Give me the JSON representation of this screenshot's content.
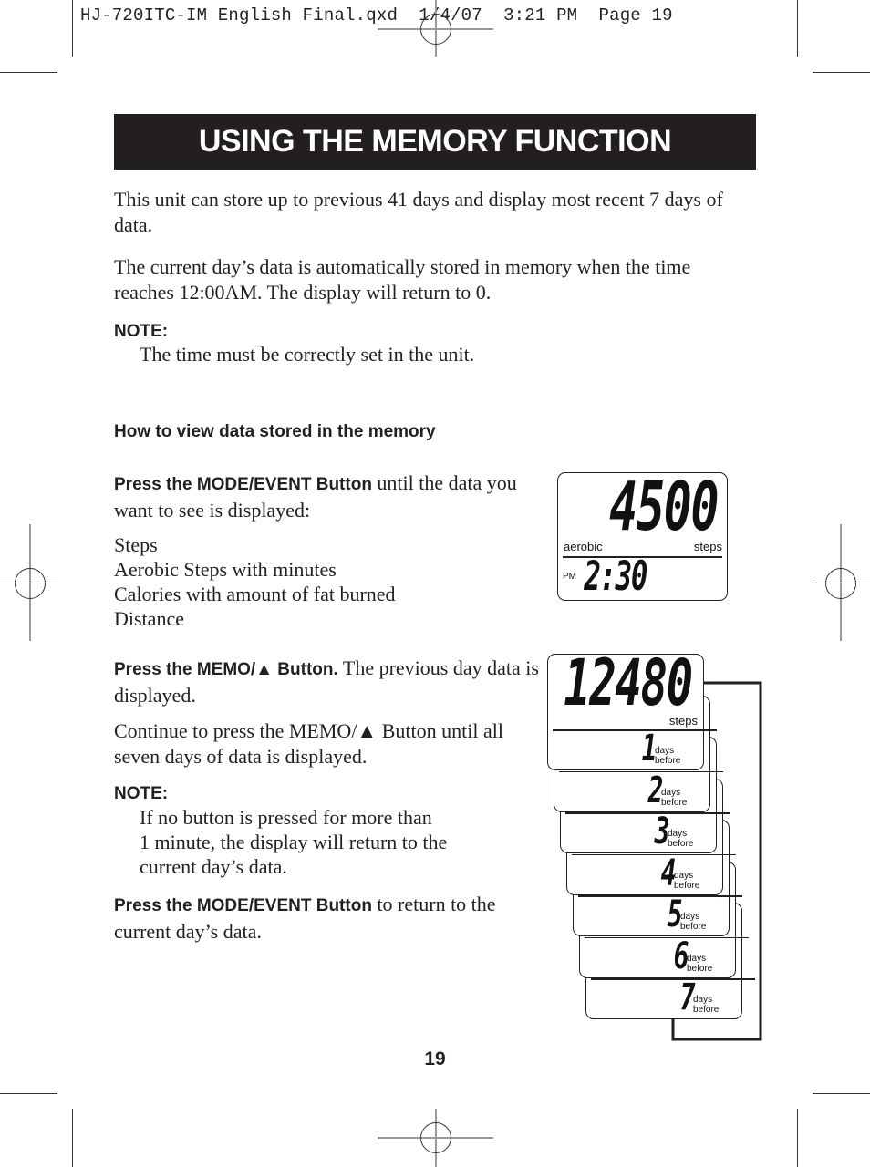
{
  "slug": "HJ-720ITC-IM English Final.qxd  1/4/07  3:21 PM  Page 19",
  "title": "USING THE MEMORY FUNCTION",
  "intro": [
    "This unit can store up to previous 41 days and display most recent 7 days of data.",
    "The current day’s data is automatically stored in memory when the time reaches 12:00AM. The display will return to 0."
  ],
  "note1": {
    "label": "NOTE:",
    "text": "The time must be correctly set in the unit."
  },
  "subheading": "How to view data stored in the memory",
  "step1": {
    "bold": "Press the MODE/EVENT Button",
    "text": " until the data you want to see is displayed:"
  },
  "modes": [
    "Steps",
    "Aerobic Steps with minutes",
    "Calories with amount of fat burned",
    "Distance"
  ],
  "display1": {
    "value": "4500",
    "left_label": "aerobic",
    "right_label": "steps",
    "ampm": "PM",
    "time": "2:30"
  },
  "step2": {
    "bold": "Press the MEMO/▲ Button.",
    "text": " The previous day data is displayed."
  },
  "continue_text": "Continue to press the MEMO/▲ Button until all seven days of data is displayed.",
  "note2": {
    "label": "NOTE:",
    "lines": [
      "If no button is pressed for more than",
      "1 minute, the display will return to the",
      "current day’s data."
    ]
  },
  "step3": {
    "bold": "Press the MODE/EVENT Button",
    "text": " to return to the current day’s data."
  },
  "display2": {
    "value": "12480",
    "unit": "steps",
    "days_label_1": "days",
    "days_label_2": "before",
    "stack": [
      "1",
      "2",
      "3",
      "4",
      "5",
      "6",
      "7"
    ]
  },
  "page_number": "19"
}
